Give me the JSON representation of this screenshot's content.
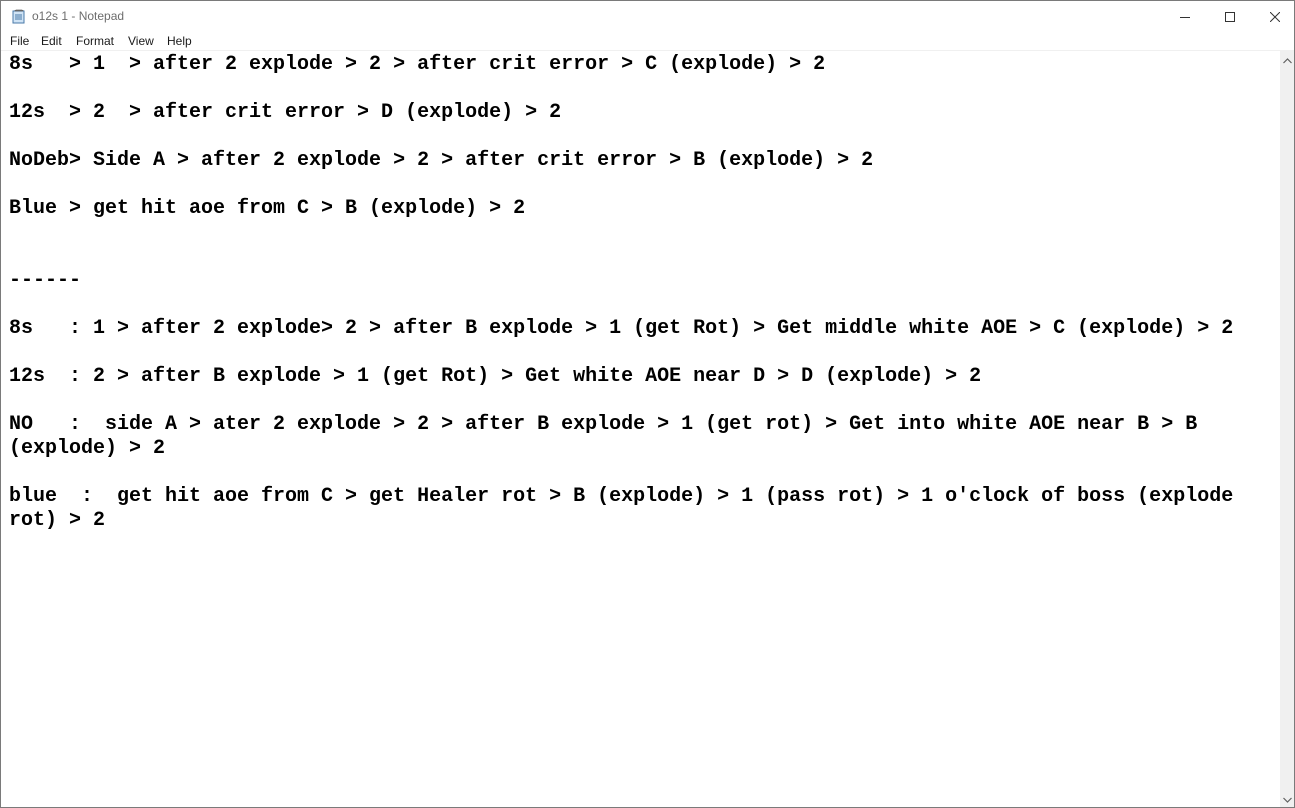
{
  "window": {
    "title": "o12s 1 - Notepad",
    "icon": "notepad-icon"
  },
  "controls": {
    "minimize_icon": "minimize-icon",
    "maximize_icon": "maximize-icon",
    "close_icon": "close-icon"
  },
  "menu": {
    "items": [
      {
        "label": "File"
      },
      {
        "label": "Edit"
      },
      {
        "label": "Format"
      },
      {
        "label": "View"
      },
      {
        "label": "Help"
      }
    ]
  },
  "editor": {
    "content": "8s   > 1  > after 2 explode > 2 > after crit error > C (explode) > 2\n\n12s  > 2  > after crit error > D (explode) > 2\n\nNoDeb> Side A > after 2 explode > 2 > after crit error > B (explode) > 2\n\nBlue > get hit aoe from C > B (explode) > 2\n\n\n------\n\n8s   : 1 > after 2 explode> 2 > after B explode > 1 (get Rot) > Get middle white AOE > C (explode) > 2\n\n12s  : 2 > after B explode > 1 (get Rot) > Get white AOE near D > D (explode) > 2\n\nNO   :  side A > ater 2 explode > 2 > after B explode > 1 (get rot) > Get into white AOE near B > B (explode) > 2\n\nblue  :  get hit aoe from C > get Healer rot > B (explode) > 1 (pass rot) > 1 o'clock of boss (explode rot) > 2"
  }
}
